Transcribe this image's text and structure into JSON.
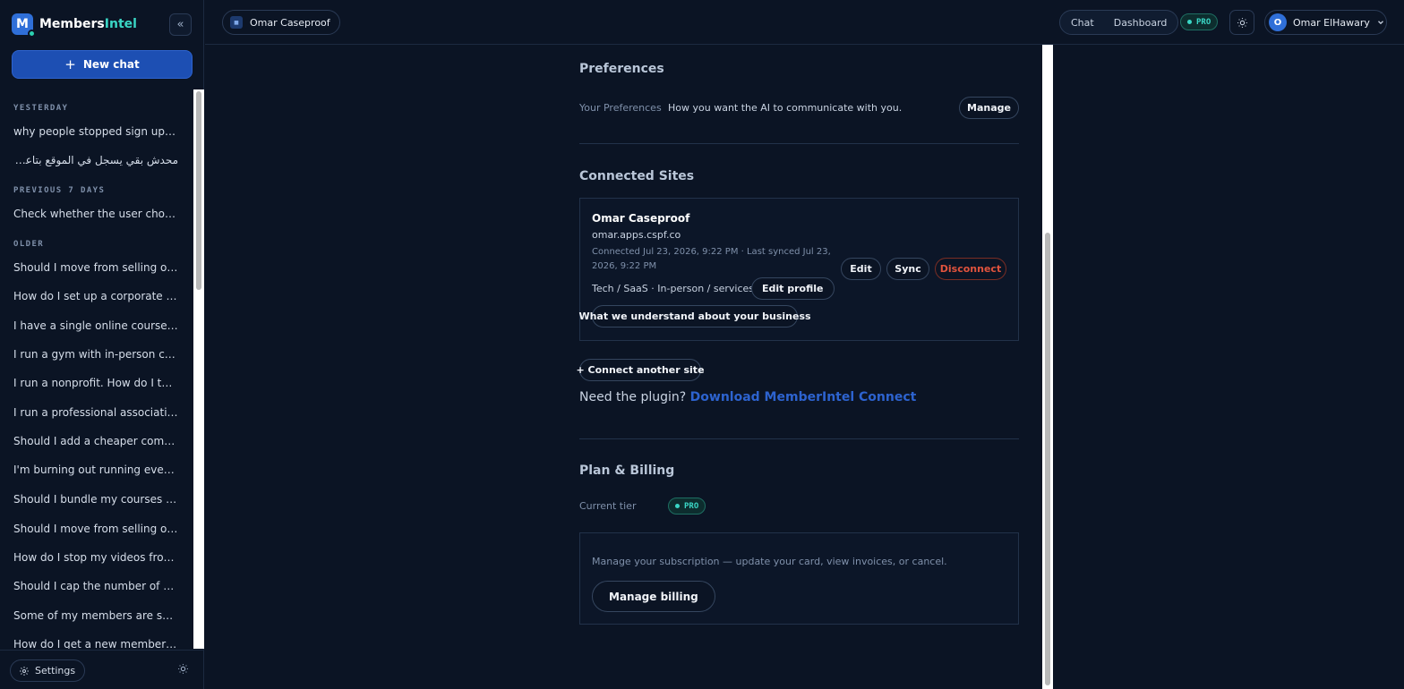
{
  "app": {
    "brand_main": "Members",
    "brand_accent": "Intel",
    "logo_letter": "M"
  },
  "sidebar": {
    "new_chat_label": "New chat",
    "sections": [
      {
        "label": "YESTERDAY",
        "items": [
          "why people stopped sign up to my website?",
          "محدش بقي يسجل في الموقع بتاعي مش فاهم"
        ]
      },
      {
        "label": "PREVIOUS 7 DAYS",
        "items": [
          "Check whether the user chose a valid plan"
        ]
      },
      {
        "label": "OLDER",
        "items": [
          "Should I move from selling one-off courses?",
          "How do I set up a corporate or group plan?",
          "I have a single online course. Should I...",
          "I run a gym with in-person classes...",
          "I run a nonprofit. How do I turn our...",
          "I run a professional association with...",
          "Should I add a cheaper community tier?",
          "I'm burning out running everything myself",
          "Should I bundle my courses together?",
          "Should I move from selling one-off courses?",
          "How do I stop my videos from being shared?",
          "Should I cap the number of devices?",
          "Some of my members are sharing logins",
          "How do I get a new member to the first win?"
        ]
      }
    ],
    "settings_label": "Settings"
  },
  "topbar": {
    "site_name": "Omar Caseproof",
    "site_favicon": "favicon-icon",
    "nav": [
      "Chat",
      "Dashboard"
    ],
    "plan_badge": "PRO",
    "user_initial": "O",
    "user_name": "Omar ElHawary"
  },
  "preferences": {
    "heading": "Preferences",
    "label": "Your Preferences",
    "description": "How you want the AI to communicate with you.",
    "manage_label": "Manage"
  },
  "connected_sites": {
    "heading": "Connected Sites",
    "site": {
      "name": "Omar Caseproof",
      "domain": "omar.apps.cspf.co",
      "meta": "Connected Jul 23, 2026, 9:22 PM · Last synced Jul 23, 2026, 9:22 PM",
      "categories": "Tech / SaaS · In-person / services",
      "edit_profile_label": "Edit profile",
      "understand_label": "What we understand about your business",
      "edit_label": "Edit",
      "sync_label": "Sync",
      "disconnect_label": "Disconnect"
    },
    "connect_another_label": "+ Connect another site",
    "plugin_prompt": "Need the plugin?",
    "plugin_link": "Download MemberIntel Connect"
  },
  "billing": {
    "heading": "Plan & Billing",
    "tier_label": "Current tier",
    "tier_value": "PRO",
    "description": "Manage your subscription — update your card, view invoices, or cancel.",
    "manage_billing_label": "Manage billing"
  },
  "colors": {
    "background": "#0b1424",
    "accent_blue": "#1d4fb3",
    "accent_teal": "#3ad6c5",
    "danger": "#e0533d"
  }
}
